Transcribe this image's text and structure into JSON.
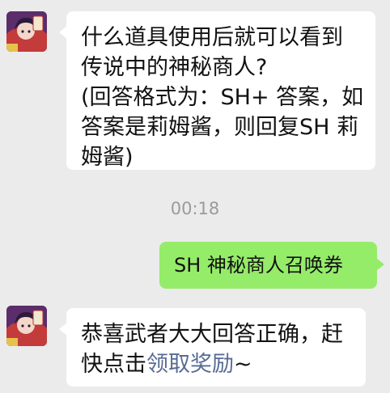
{
  "conversation": {
    "messages": [
      {
        "sender": "bot",
        "lines": [
          "什么道具使用后就可以看到",
          "传说中的神秘商人?",
          "(回答格式为：SH+ 答案，如",
          "答案是莉姆酱，则回复SH 莉",
          "姆酱)"
        ]
      },
      {
        "timestamp": "00:18"
      },
      {
        "sender": "user",
        "text": "SH 神秘商人召唤券"
      },
      {
        "sender": "bot",
        "line1": "恭喜武者大大回答正确，赶",
        "line2_prefix": "快点击",
        "link_text": "领取奖励",
        "line2_suffix": "~"
      }
    ]
  },
  "colors": {
    "background": "#ebebeb",
    "bubble_in": "#ffffff",
    "bubble_out": "#95ec69",
    "link": "#576b95",
    "timestamp": "#9b9b9b"
  }
}
